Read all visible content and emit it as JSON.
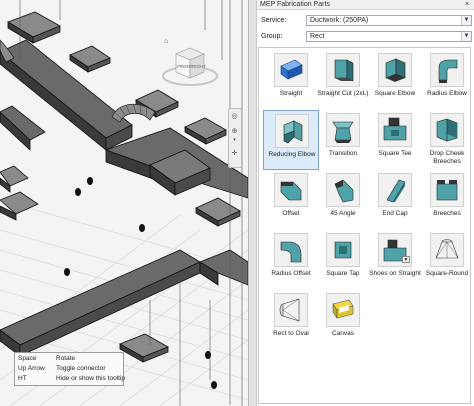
{
  "panel": {
    "title": "MEP Fabrication Parts",
    "service_label": "Service:",
    "service_value": "Ductwork: (250PA)",
    "group_label": "Group:",
    "group_value": "Rect"
  },
  "parts": [
    {
      "label": "Straight",
      "icon": "straight-icon",
      "selected": false
    },
    {
      "label": "Straight Cut (2xL)",
      "icon": "straight-cut-icon",
      "selected": false
    },
    {
      "label": "Square Elbow",
      "icon": "square-elbow-icon",
      "selected": false
    },
    {
      "label": "Radius Elbow",
      "icon": "radius-elbow-icon",
      "selected": false
    },
    {
      "label": "Reducing Elbow",
      "icon": "reducing-elbow-icon",
      "selected": true
    },
    {
      "label": "Transition",
      "icon": "transition-icon",
      "selected": false
    },
    {
      "label": "Square Tee",
      "icon": "square-tee-icon",
      "selected": false
    },
    {
      "label": "Drop Cheek Breeches",
      "icon": "drop-cheek-breeches-icon",
      "selected": false
    },
    {
      "label": "Offset",
      "icon": "offset-icon",
      "selected": false
    },
    {
      "label": "45 Angle",
      "icon": "angle-45-icon",
      "selected": false
    },
    {
      "label": "End Cap",
      "icon": "end-cap-icon",
      "selected": false
    },
    {
      "label": "Breeches",
      "icon": "breeches-icon",
      "selected": false
    },
    {
      "label": "Radius Offset",
      "icon": "radius-offset-icon",
      "selected": false
    },
    {
      "label": "Square Tap",
      "icon": "square-tap-icon",
      "selected": false
    },
    {
      "label": "Shoes on Straight",
      "icon": "shoes-on-straight-icon",
      "selected": false
    },
    {
      "label": "Square-Round",
      "icon": "square-round-icon",
      "selected": false
    },
    {
      "label": "Rect to Oval",
      "icon": "rect-to-oval-icon",
      "selected": false
    },
    {
      "label": "Canvas",
      "icon": "canvas-icon",
      "selected": false
    }
  ],
  "tooltip": {
    "rows": [
      {
        "key": "Space",
        "value": "Rotate"
      },
      {
        "key": "Up Arrow",
        "value": "Toggle connector"
      },
      {
        "key": "HT",
        "value": "Hide or show this tooltip"
      }
    ]
  },
  "viewcube": {
    "front_label": "FRONT",
    "right_label": "RIGHT"
  },
  "colors": {
    "duct_top": "#6a6a6a",
    "duct_side": "#3a3a3a",
    "part_face": "#4fa3a8",
    "straight_face": "#2f6fd0",
    "selected_bg": "#dcebfc"
  }
}
